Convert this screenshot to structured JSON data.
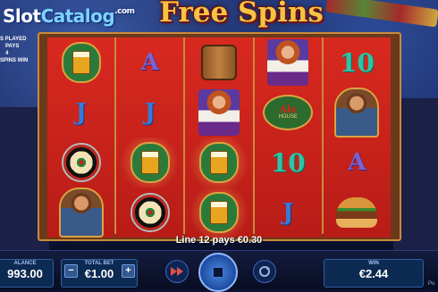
{
  "logo": {
    "name_a": "Slot",
    "name_b": "Catalog",
    "domain": ".com"
  },
  "title": "Free Spins",
  "info_lines": [
    "S PLAYED",
    "PAYS",
    "4",
    "SPINS WIN"
  ],
  "reels": [
    [
      {
        "type": "beer",
        "icon": "beer-mug-icon",
        "win": false
      },
      {
        "type": "letter",
        "text": "J",
        "cls": "sym-j",
        "win": false
      },
      {
        "type": "dartboard",
        "icon": "dartboard-icon",
        "win": false
      },
      {
        "type": "man",
        "icon": "bartender-man-icon",
        "win": false
      }
    ],
    [
      {
        "type": "letter",
        "text": "A",
        "cls": "sym-a",
        "win": false
      },
      {
        "type": "letter",
        "text": "J",
        "cls": "sym-j",
        "win": false
      },
      {
        "type": "beer",
        "icon": "beer-mug-icon",
        "win": true
      },
      {
        "type": "dartboard",
        "icon": "dartboard-icon",
        "win": false
      }
    ],
    [
      {
        "type": "barrel",
        "icon": "ale-barrel-icon",
        "win": false
      },
      {
        "type": "woman",
        "icon": "barmaid-icon",
        "win": false
      },
      {
        "type": "beer",
        "icon": "beer-mug-icon",
        "win": true
      },
      {
        "type": "beer",
        "icon": "beer-mug-icon",
        "win": true
      }
    ],
    [
      {
        "type": "woman",
        "icon": "barmaid-icon",
        "win": false
      },
      {
        "type": "sign",
        "icon": "ale-house-sign-icon",
        "top": "Ale",
        "bottom": "HOUSE",
        "win": false
      },
      {
        "type": "letter",
        "text": "10",
        "cls": "sym-10",
        "win": false
      },
      {
        "type": "letter",
        "text": "J",
        "cls": "sym-j",
        "win": false
      }
    ],
    [
      {
        "type": "letter",
        "text": "10",
        "cls": "sym-10",
        "win": false
      },
      {
        "type": "man",
        "icon": "bartender-man-icon",
        "win": false
      },
      {
        "type": "letter",
        "text": "A",
        "cls": "sym-a",
        "win": false
      },
      {
        "type": "burger",
        "icon": "burger-icon",
        "win": false
      }
    ]
  ],
  "win_message": "Line 12 pays €0.30",
  "balance": {
    "label": "ALANCE",
    "value": "993.00"
  },
  "total_bet": {
    "label": "TOTAL BET",
    "value": "€1.00",
    "minus": "−",
    "plus": "+"
  },
  "win": {
    "label": "WIN",
    "value": "€2.44"
  },
  "corner_text": "Pu",
  "colors": {
    "reel_red": "#c8231b",
    "frame_gold": "#c98b3b",
    "panel_blue": "#0d2a52"
  }
}
